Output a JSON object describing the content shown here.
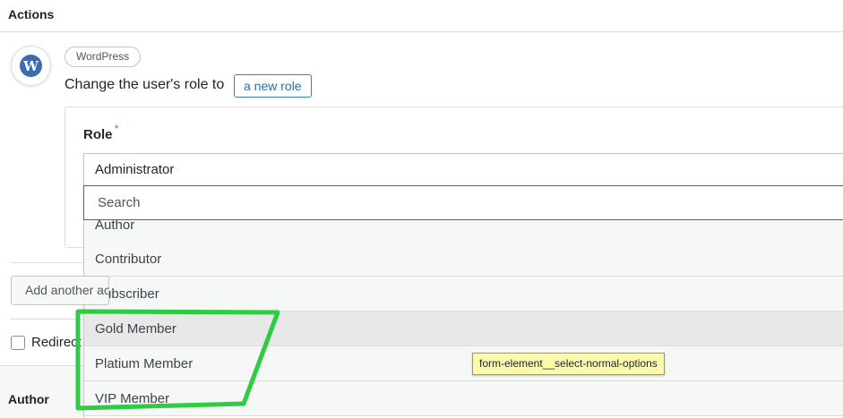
{
  "actions": {
    "title": "Actions"
  },
  "action_card": {
    "icon": "wordpress-icon",
    "integration_label": "WordPress",
    "sentence": "Change the user's role to",
    "role_link": "a new role"
  },
  "role_field": {
    "label": "Role",
    "required_mark": "*",
    "selected_value": "Administrator",
    "search_placeholder": "Search",
    "options": [
      "Author",
      "Contributor",
      "Subscriber",
      "Gold Member",
      "Platium Member",
      "VIP Member"
    ],
    "hovered_option": "Gold Member"
  },
  "add_action_button": "Add another action",
  "redirect_checkbox_label": "Redirect",
  "author_section": {
    "title": "Author"
  },
  "tooltip": "form-element__select-normal-options",
  "colors": {
    "accent": "#2271b1",
    "annotation": "#2ecc40",
    "tooltip_bg": "#fdfab0",
    "required": "#d63638"
  }
}
